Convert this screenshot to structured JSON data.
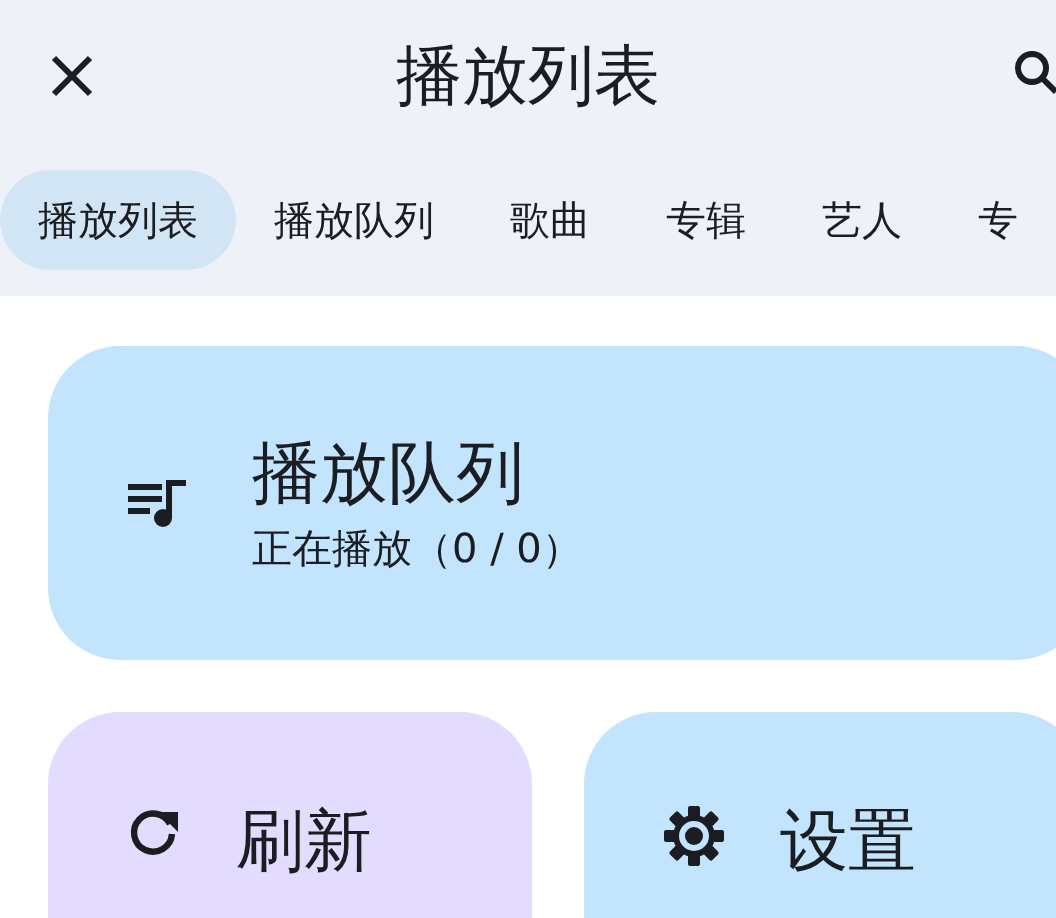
{
  "top_bar": {
    "title": "播放列表"
  },
  "tabs": [
    {
      "label": "播放列表",
      "selected": true
    },
    {
      "label": "播放队列",
      "selected": false
    },
    {
      "label": "歌曲",
      "selected": false
    },
    {
      "label": "专辑",
      "selected": false
    },
    {
      "label": "艺人",
      "selected": false
    },
    {
      "label": "专",
      "selected": false
    }
  ],
  "cards": [
    {
      "kind": "queue",
      "title": "播放队列",
      "subtitle": "正在播放（0 / 0）"
    },
    {
      "kind": "refresh",
      "title": "刷新"
    },
    {
      "kind": "settings",
      "title": "设置"
    }
  ]
}
